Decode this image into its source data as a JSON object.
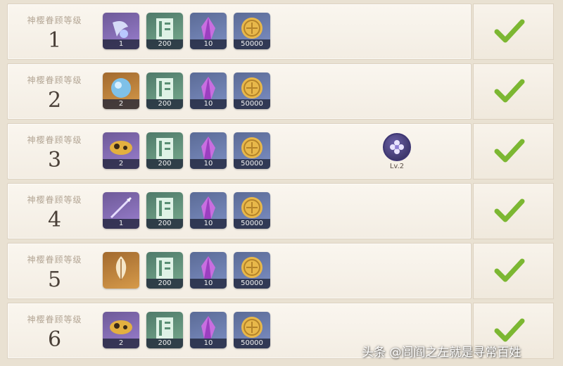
{
  "level_label": "神樱眷顾等级",
  "rows": [
    {
      "level": "1",
      "items": [
        {
          "icon": "blue-talisman-icon",
          "count": "1"
        },
        {
          "icon": "exp-book-icon",
          "count": "200"
        },
        {
          "icon": "crystal-icon",
          "count": "10"
        },
        {
          "icon": "mora-coin-icon",
          "count": "50000"
        }
      ]
    },
    {
      "level": "2",
      "items": [
        {
          "icon": "orb-icon",
          "count": "2"
        },
        {
          "icon": "exp-book-icon",
          "count": "200"
        },
        {
          "icon": "crystal-icon",
          "count": "10"
        },
        {
          "icon": "mora-coin-icon",
          "count": "50000"
        }
      ]
    },
    {
      "level": "3",
      "items": [
        {
          "icon": "gold-mask-icon",
          "count": "2"
        },
        {
          "icon": "exp-book-icon",
          "count": "200"
        },
        {
          "icon": "crystal-icon",
          "count": "10"
        },
        {
          "icon": "mora-coin-icon",
          "count": "50000"
        }
      ]
    },
    {
      "level": "4",
      "items": [
        {
          "icon": "spear-icon",
          "count": "1"
        },
        {
          "icon": "exp-book-icon",
          "count": "200"
        },
        {
          "icon": "crystal-icon",
          "count": "10"
        },
        {
          "icon": "mora-coin-icon",
          "count": "50000"
        }
      ]
    },
    {
      "level": "5",
      "items": [
        {
          "icon": "gold-feather-icon",
          "count": ""
        },
        {
          "icon": "exp-book-icon",
          "count": "200"
        },
        {
          "icon": "crystal-icon",
          "count": "10"
        },
        {
          "icon": "mora-coin-icon",
          "count": "50000"
        }
      ]
    },
    {
      "level": "6",
      "items": [
        {
          "icon": "gold-mask-icon",
          "count": "2"
        },
        {
          "icon": "exp-book-icon",
          "count": "200"
        },
        {
          "icon": "crystal-icon",
          "count": "10"
        },
        {
          "icon": "mora-coin-icon",
          "count": "50000"
        }
      ]
    }
  ],
  "bonus": {
    "label": "Lv.2"
  },
  "watermark": "头条 @闾阎之左就是寻常百姓",
  "colors": {
    "check": "#7cb732",
    "level_text": "#4a4038"
  }
}
